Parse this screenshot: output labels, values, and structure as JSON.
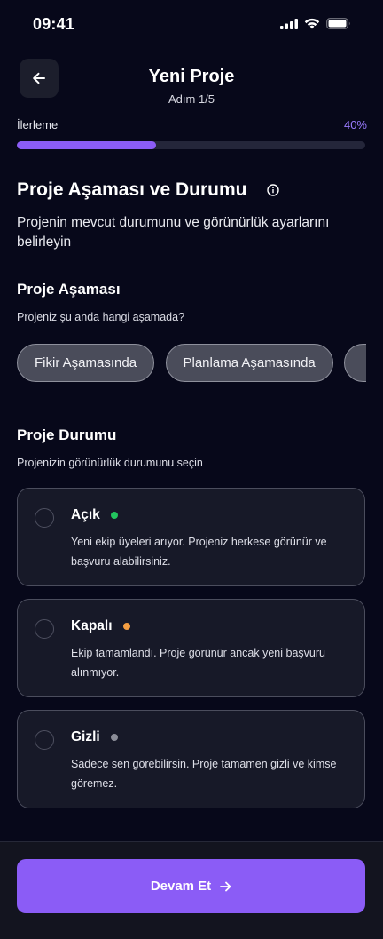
{
  "status_bar": {
    "time": "09:41"
  },
  "header": {
    "title": "Yeni Proje",
    "step": "Adım 1/5"
  },
  "progress": {
    "label": "İlerleme",
    "percent_text": "40%",
    "value": 0.4,
    "color": "#8b5cf6"
  },
  "section": {
    "title": "Proje Aşaması ve Durumu",
    "description": "Projenin mevcut durumunu ve görünürlük ayarlarını belirleyin"
  },
  "stage": {
    "title": "Proje Aşaması",
    "question": "Projeniz şu anda hangi aşamada?",
    "options": [
      "Fikir Aşamasında",
      "Planlama Aşamasında",
      ""
    ]
  },
  "status": {
    "title": "Proje Durumu",
    "question": "Projenizin görünürlük durumunu seçin",
    "options": [
      {
        "label": "Açık",
        "description": "Yeni ekip üyeleri arıyor. Projeniz herkese görünür ve başvuru alabilirsiniz.",
        "dot_color": "#22c55e"
      },
      {
        "label": "Kapalı",
        "description": "Ekip tamamlandı. Proje görünür ancak yeni başvuru alınmıyor.",
        "dot_color": "#f59e42"
      },
      {
        "label": "Gizli",
        "description": "Sadece sen görebilirsin. Proje tamamen gizli ve kimse göremez.",
        "dot_color": "#8b8d98"
      }
    ]
  },
  "footer": {
    "continue_label": "Devam Et"
  }
}
